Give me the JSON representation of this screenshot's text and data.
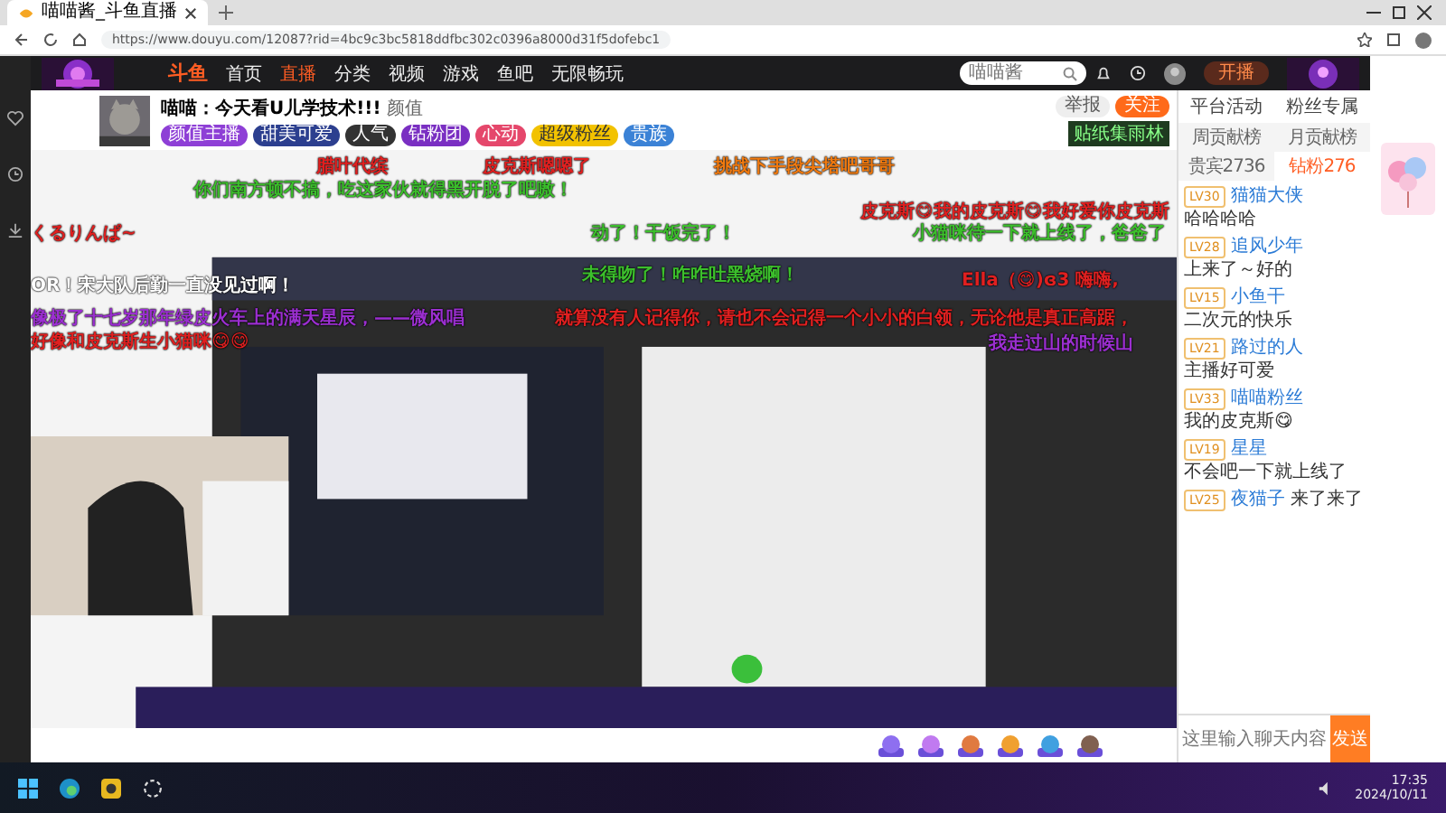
{
  "browser": {
    "tab_title": "喵喵酱_斗鱼直播",
    "url": "https://www.douyu.com/12087?rid=4bc9c3bc5818ddfbc302c0396a8000d31f5dofebc1"
  },
  "header": {
    "logo": "斗鱼",
    "nav": [
      {
        "label": "首页",
        "selected": false
      },
      {
        "label": "直播",
        "selected": true
      },
      {
        "label": "分类",
        "selected": false
      },
      {
        "label": "视频",
        "selected": false
      },
      {
        "label": "游戏",
        "selected": false
      },
      {
        "label": "鱼吧",
        "selected": false
      },
      {
        "label": "无限畅玩",
        "selected": false
      }
    ],
    "search": {
      "placeholder": "喵喵酱"
    },
    "start_button": "开播"
  },
  "room": {
    "title": "喵喵：今天看U儿学技术!!!",
    "category": "颜值",
    "tags": [
      {
        "label": "颜值主播",
        "color": "#8e3fd6"
      },
      {
        "label": "甜美可爱",
        "color": "#2c3f8f"
      },
      {
        "label": "人气",
        "color": "#333333"
      },
      {
        "label": "钻粉团",
        "color": "#7a2fc2"
      },
      {
        "label": "心动",
        "color": "#e5476b"
      },
      {
        "label": "超级粉丝",
        "color": "#f2c200"
      },
      {
        "label": "贵族",
        "color": "#3b82d6"
      }
    ],
    "actions": [
      {
        "label": "举报"
      },
      {
        "label": "关注"
      }
    ],
    "badge": "贴纸集雨林"
  },
  "danmaku": [
    {
      "text": "腊叶代缤",
      "color": "#e02020"
    },
    {
      "text": "皮克斯嗯嗯了",
      "color": "#e02020"
    },
    {
      "text": "挑战下手段尖塔吧哥哥",
      "color": "#f07a10"
    },
    {
      "text": "你们南方顿不搞，吃这家伙就得黑开脱了吧嗷！",
      "color": "#3cbf2c"
    },
    {
      "text": "皮克斯😋我的皮克斯😋我好爱你皮克斯",
      "color": "#e02020"
    },
    {
      "text": "くるりんぱ~",
      "color": "#e02020"
    },
    {
      "text": "动了！干饭完了！",
      "color": "#3cbf2c"
    },
    {
      "text": "小猫咪待一下就上线了，爸爸了",
      "color": "#3cbf2c"
    },
    {
      "text": "OR！宋大队后勤一直没见过啊！",
      "color": "#ffffff"
    },
    {
      "text": "未得吻了！咋咋吐黑烧啊！",
      "color": "#3cbf2c"
    },
    {
      "text": "Ella（😋)ɞ3 嗨嗨,",
      "color": "#e02020"
    },
    {
      "text": "像极了十七岁那年绿皮火车上的满天星辰，——微风唱",
      "color": "#9b2fd0"
    },
    {
      "text": "好像和皮克斯生小猫咪😋😋",
      "color": "#e02020"
    },
    {
      "text": "就算没有人记得你，请也不会记得一个小小的白领，无论他是真正高踞，",
      "color": "#e02020"
    },
    {
      "text": "我走过山的时候山",
      "color": "#9b2fd0"
    }
  ],
  "chat": {
    "activities": [
      {
        "label": "平台活动"
      },
      {
        "label": "粉丝专属"
      }
    ],
    "tabs": [
      {
        "label": "周贡献榜",
        "selected": false
      },
      {
        "label": "月贡献榜",
        "selected": false
      },
      {
        "label": "贵宾2736",
        "selected": false
      },
      {
        "label": "钻粉276",
        "selected": true
      }
    ],
    "messages": [
      {
        "level": "LV30",
        "name": "猫猫大侠",
        "text": "哈哈哈哈"
      },
      {
        "level": "LV28",
        "name": "追风少年",
        "text": "上来了～好的"
      },
      {
        "level": "LV15",
        "name": "小鱼干",
        "text": "二次元的快乐"
      },
      {
        "level": "LV21",
        "name": "路过的人",
        "text": "主播好可爱"
      },
      {
        "level": "LV33",
        "name": "喵喵粉丝",
        "text": "我的皮克斯😋"
      },
      {
        "level": "LV19",
        "name": "星星",
        "text": "不会吧一下就上线了"
      },
      {
        "level": "LV25",
        "name": "夜猫子",
        "text": "来了来了"
      }
    ],
    "input": {
      "placeholder": "这里输入聊天内容"
    },
    "send_button": "发送"
  },
  "taskbar": {
    "time": "17:35",
    "date": "2024/10/11"
  }
}
